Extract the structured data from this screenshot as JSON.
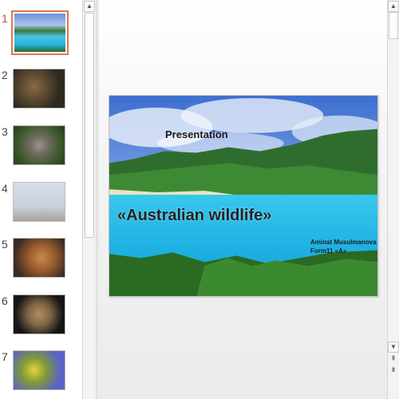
{
  "thumbnails": [
    {
      "number": "1",
      "active": true
    },
    {
      "number": "2",
      "active": false
    },
    {
      "number": "3",
      "active": false
    },
    {
      "number": "4",
      "active": false
    },
    {
      "number": "5",
      "active": false
    },
    {
      "number": "6",
      "active": false
    },
    {
      "number": "7",
      "active": false
    }
  ],
  "slide": {
    "title": "Presentation",
    "headline": "«Australian wildlife»",
    "author_line1": "Aminat  Musulmanova",
    "author_line2": "Form11 «A»"
  },
  "colors": {
    "active_thumb_border": "#e0764f",
    "active_number": "#c0504d"
  },
  "icons": {
    "scroll_up": "scroll-up-icon",
    "scroll_down": "scroll-down-icon",
    "prev_slide": "previous-slide-icon",
    "next_slide": "next-slide-icon"
  }
}
